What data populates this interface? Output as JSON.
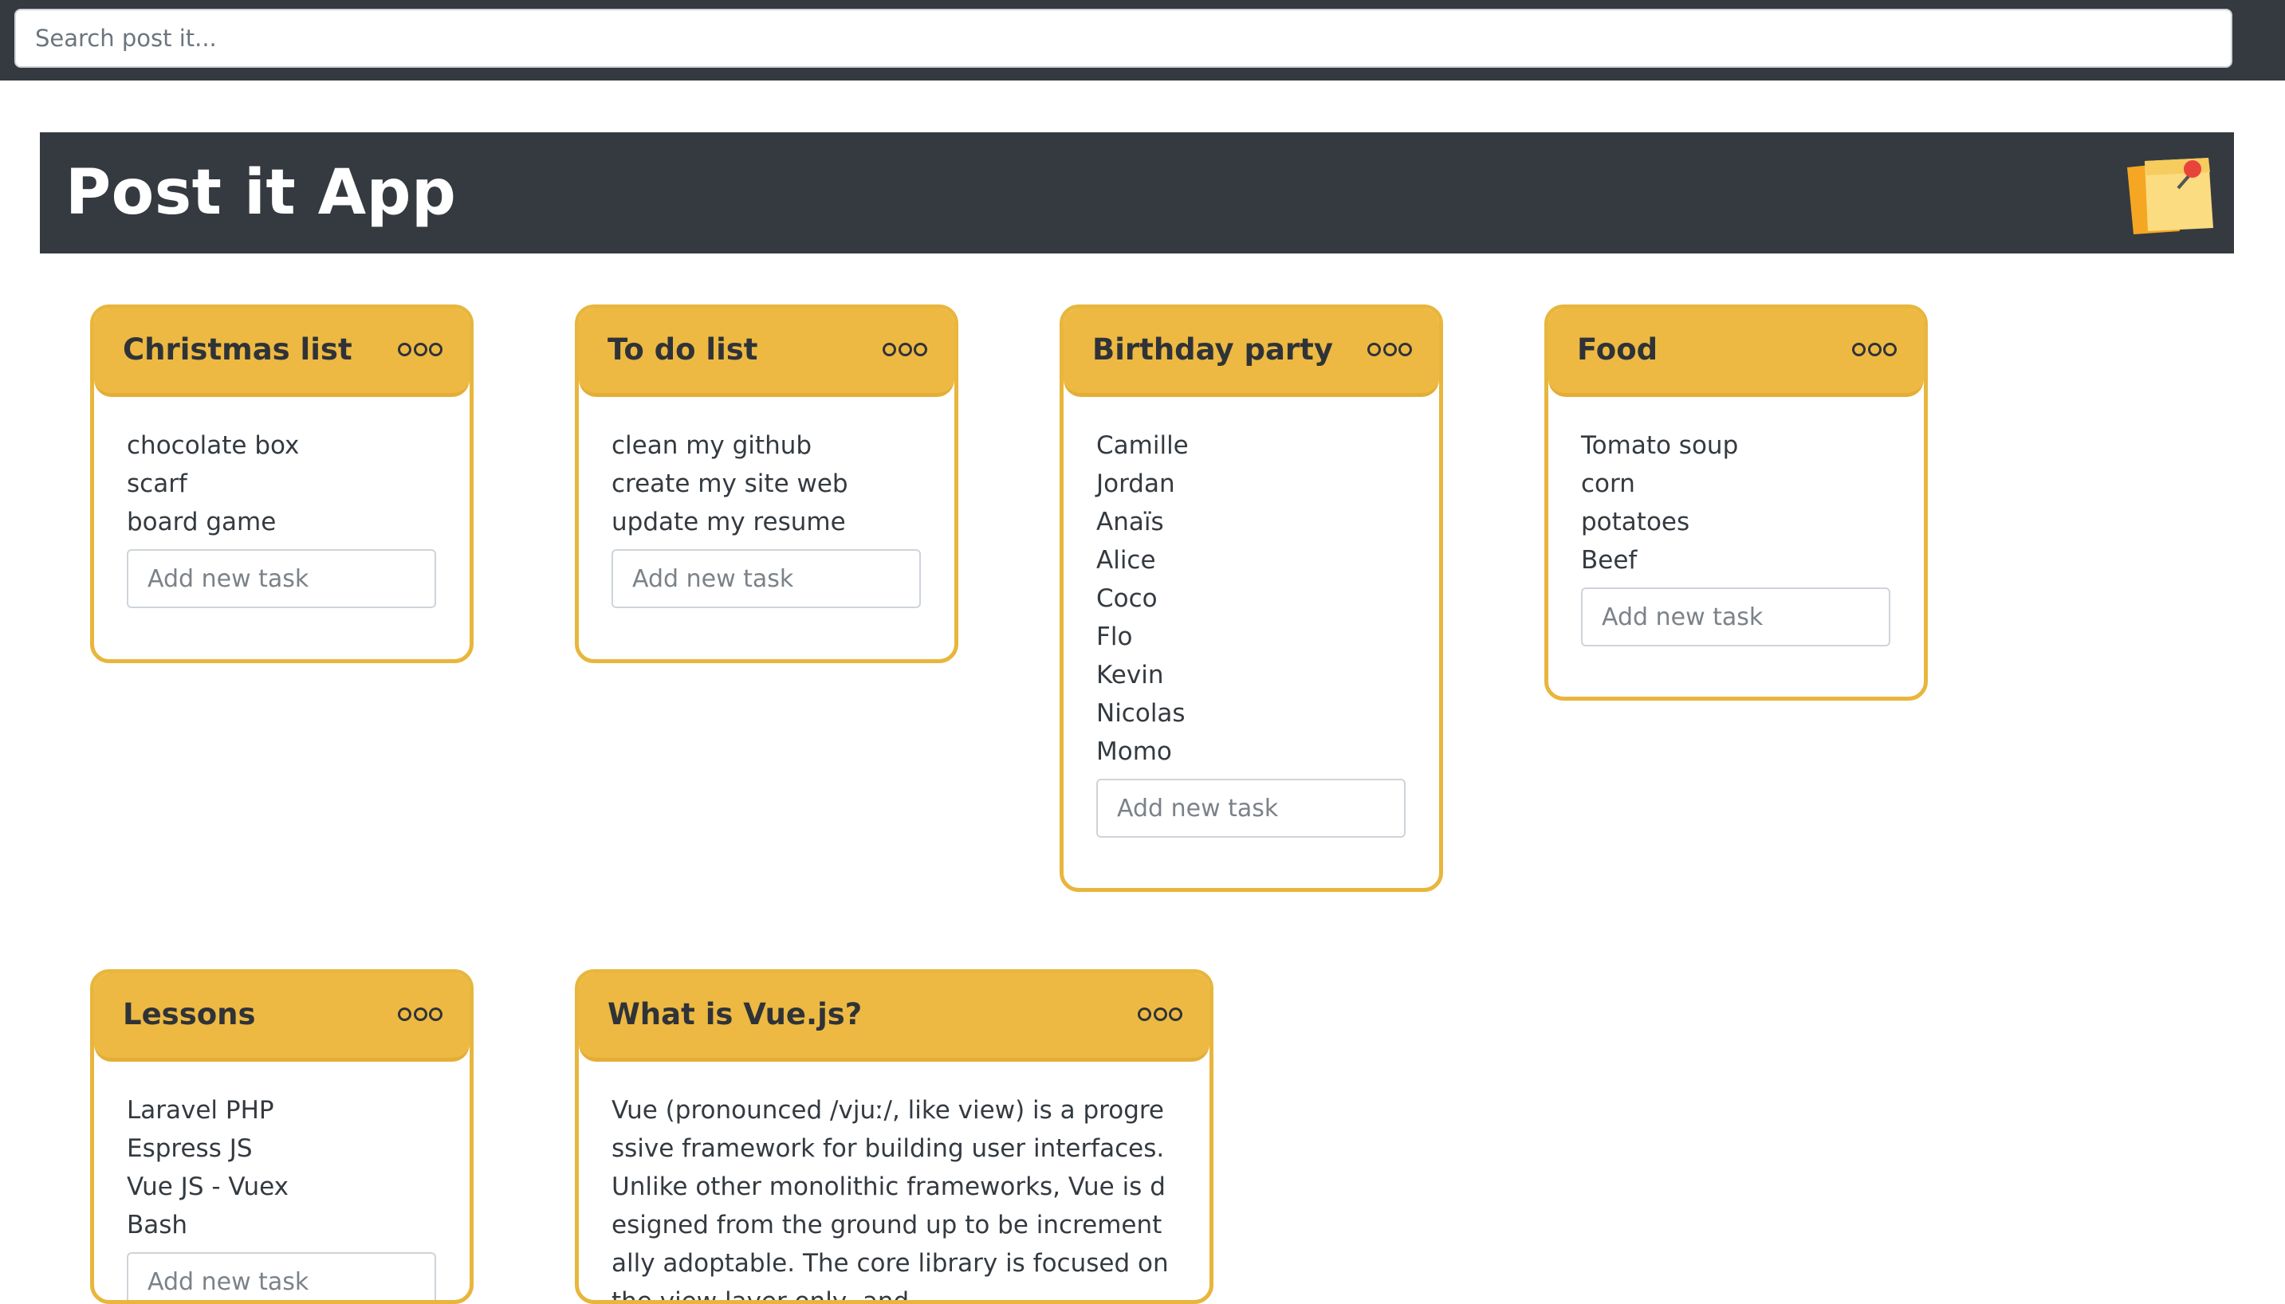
{
  "search": {
    "placeholder": "Search post it..."
  },
  "header": {
    "title": "Post it App"
  },
  "colors": {
    "header_bg": "#343a40",
    "card_accent": "#edb942",
    "card_border": "#e8b63d"
  },
  "cards": [
    {
      "title": "Christmas list",
      "menu_icon": "more-dots-icon",
      "tasks": [
        "chocolate box",
        "scarf",
        "board game"
      ],
      "input_placeholder": "Add new task"
    },
    {
      "title": "To do list",
      "menu_icon": "more-dots-icon",
      "tasks": [
        "clean my github",
        "create my site web",
        "update my resume"
      ],
      "input_placeholder": "Add new task"
    },
    {
      "title": "Birthday party",
      "menu_icon": "more-dots-icon",
      "tasks": [
        "Camille",
        "Jordan",
        "Anaïs",
        "Alice",
        "Coco",
        "Flo",
        "Kevin",
        "Nicolas",
        "Momo"
      ],
      "input_placeholder": "Add new task"
    },
    {
      "title": "Food",
      "menu_icon": "more-dots-icon",
      "tasks": [
        "Tomato soup",
        "corn",
        "potatoes",
        "Beef"
      ],
      "input_placeholder": "Add new task"
    },
    {
      "title": "Lessons",
      "menu_icon": "more-dots-icon",
      "tasks": [
        "Laravel PHP",
        "Espress JS",
        "Vue JS - Vuex",
        "Bash"
      ],
      "input_placeholder": "Add new task"
    },
    {
      "title": "What is Vue.js?",
      "menu_icon": "more-dots-icon",
      "text": "Vue (pronounced /vjuː/, like view) is a progressive framework for building user interfaces. Unlike other monolithic frameworks, Vue is designed from the ground up to be incrementally adoptable. The core library is focused on the view layer only, and"
    }
  ]
}
